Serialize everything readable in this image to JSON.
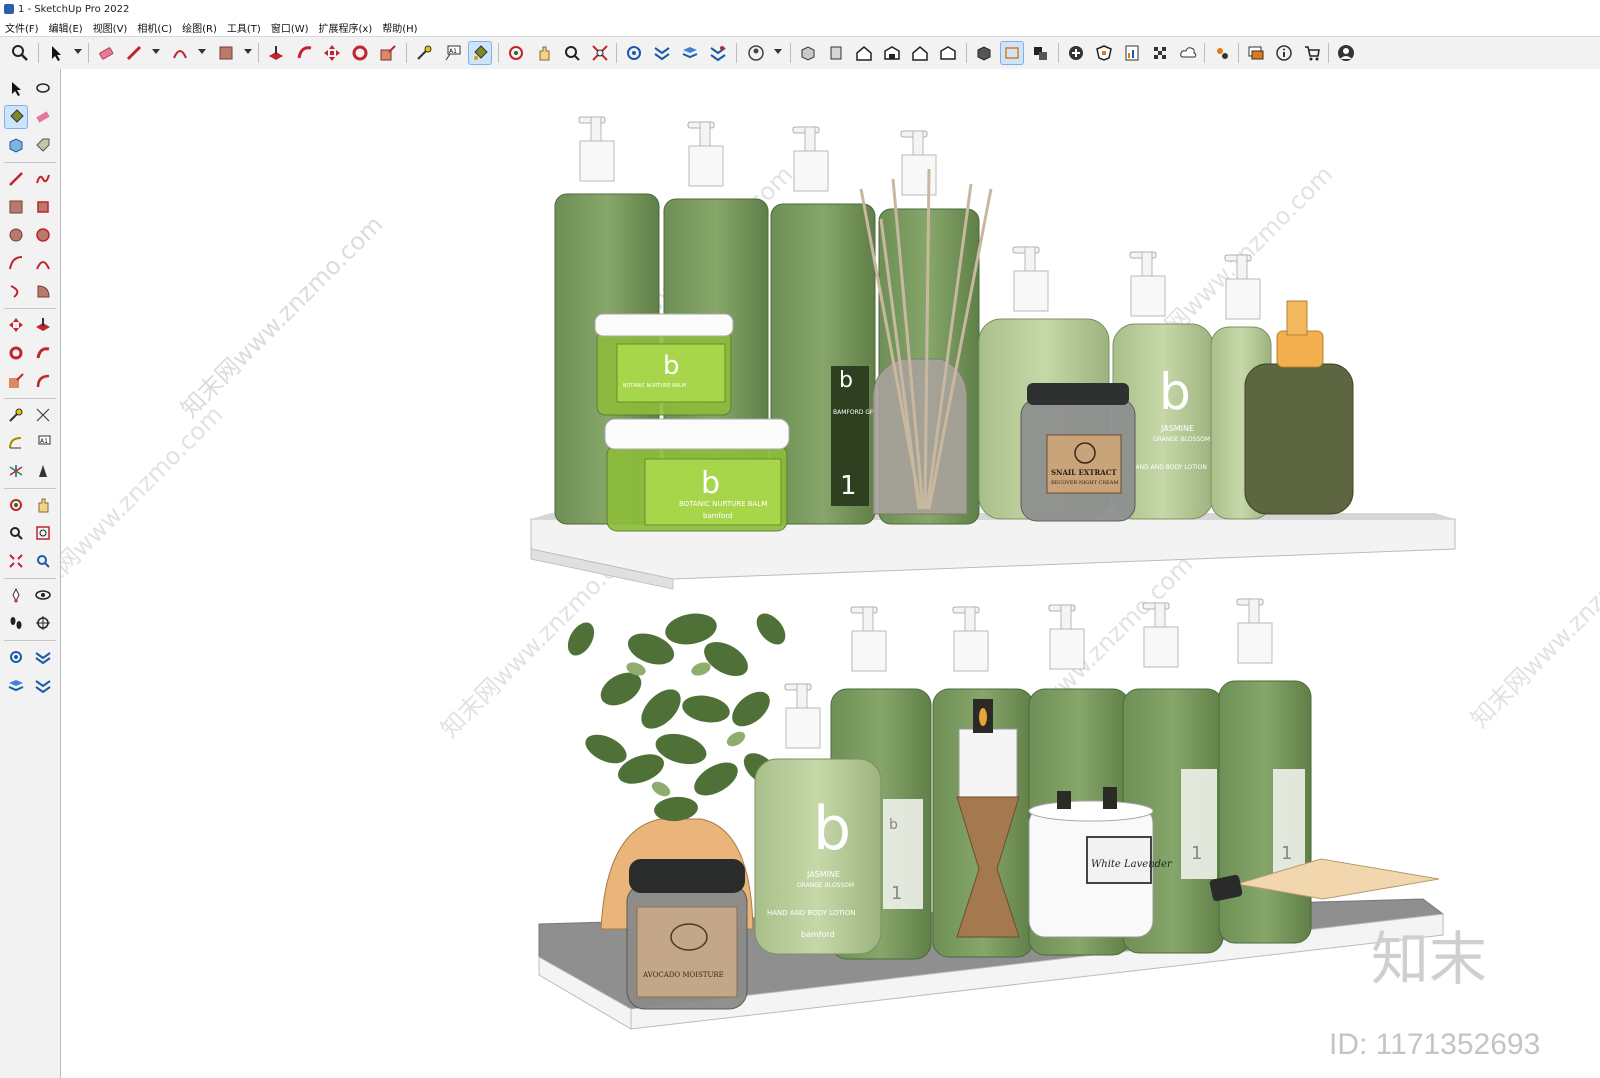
{
  "window": {
    "title": "1 - SketchUp Pro 2022"
  },
  "menu": [
    "文件(F)",
    "编辑(E)",
    "视图(V)",
    "相机(C)",
    "绘图(R)",
    "工具(T)",
    "窗口(W)",
    "扩展程序(x)",
    "帮助(H)"
  ],
  "scene": {
    "labels": {
      "jar_b": "b",
      "jar_line1": "BOTANIC NURTURE BALM",
      "jar_line2": "bamford",
      "bottle_b": "b",
      "bottle_num": "1",
      "bamford_label": "BAMFORD GROOMING DEPARTM",
      "snail_line1": "SNAIL EXTRACT",
      "snail_line2": "RECOVER NIGHT CREAM",
      "jasmine_line1": "JASMINE",
      "jasmine_line2": "ORANGE BLOSSOM",
      "jasmine_line3": "HAND AND BODY LOTION",
      "bamford_small": "bamford",
      "avocado": "AVOCADO MOISTURE",
      "white_lavender": "White Lavender"
    },
    "watermark": "知末网www.znzmo.com",
    "brand": "知末",
    "id": "ID: 1171352693"
  },
  "colors": {
    "bottle_green": "#7d9e62",
    "lime_label": "#8dc63f",
    "shelf": "#f4f4f4",
    "shelf_edge": "#bdbdbd",
    "pump_white": "#f7f7f7"
  }
}
